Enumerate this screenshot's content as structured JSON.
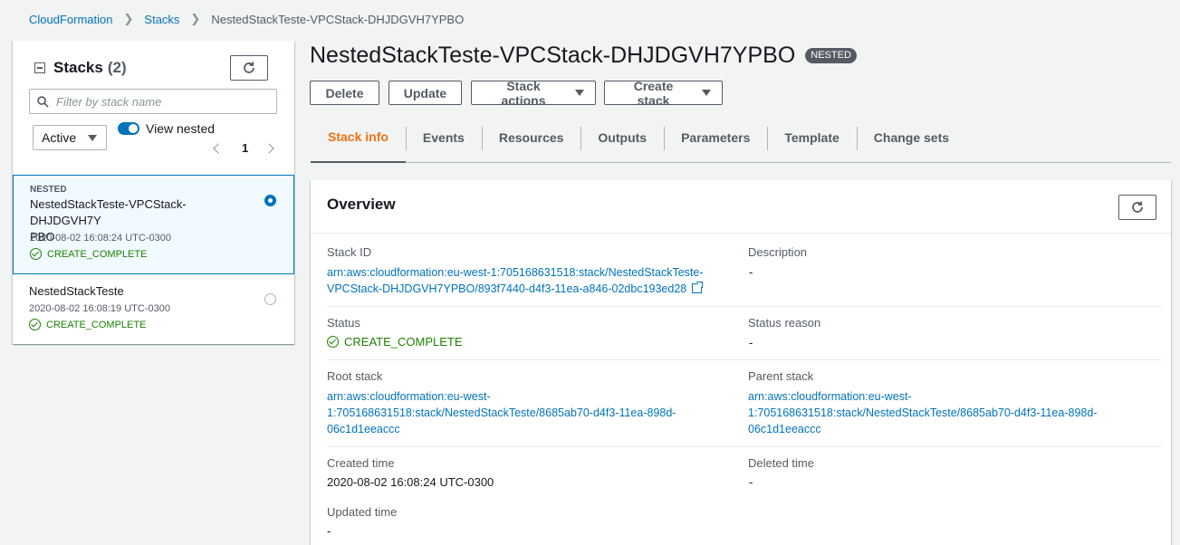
{
  "breadcrumb": {
    "items": [
      "CloudFormation",
      "Stacks"
    ],
    "current": "NestedStackTeste-VPCStack-DHJDGVH7YPBO"
  },
  "sidebar": {
    "title": "Stacks",
    "count": "(2)",
    "search_placeholder": "Filter by stack name",
    "filter_value": "Active",
    "view_nested_label": "View nested",
    "view_nested_on": true,
    "page": "1",
    "stacks": [
      {
        "tag": "NESTED",
        "name": "NestedStackTeste-VPCStack-DHJDGVH7YPBO",
        "name_line1": "NestedStackTeste-VPCStack-DHJDGVH7Y",
        "name_line2": "PBO",
        "date": "2020-08-02 16:08:24 UTC-0300",
        "status": "CREATE_COMPLETE",
        "selected": true
      },
      {
        "tag": "",
        "name": "NestedStackTeste",
        "date": "2020-08-02 16:08:19 UTC-0300",
        "status": "CREATE_COMPLETE",
        "selected": false
      }
    ]
  },
  "header": {
    "title": "NestedStackTeste-VPCStack-DHJDGVH7YPBO",
    "badge": "NESTED"
  },
  "actions": {
    "delete": "Delete",
    "update": "Update",
    "stack_actions": "Stack actions",
    "create_stack": "Create stack"
  },
  "tabs": [
    "Stack info",
    "Events",
    "Resources",
    "Outputs",
    "Parameters",
    "Template",
    "Change sets"
  ],
  "active_tab": "Stack info",
  "overview": {
    "title": "Overview",
    "stack_id_label": "Stack ID",
    "stack_id_line1": "arn:aws:cloudformation:eu-west-1:705168631518:stack/NestedStackTeste-",
    "stack_id_line2": "VPCStack-DHJDGVH7YPBO/893f7440-d4f3-11ea-a846-02dbc193ed28",
    "description_label": "Description",
    "description_value": "-",
    "status_label": "Status",
    "status_value": "CREATE_COMPLETE",
    "status_reason_label": "Status reason",
    "status_reason_value": "-",
    "root_stack_label": "Root stack",
    "root_stack_line1": "arn:aws:cloudformation:eu-west-",
    "root_stack_line2": "1:705168631518:stack/NestedStackTeste/8685ab70-d4f3-11ea-898d-",
    "root_stack_line3": "06c1d1eeaccc",
    "parent_stack_label": "Parent stack",
    "parent_stack_line1": "arn:aws:cloudformation:eu-west-",
    "parent_stack_line2": "1:705168631518:stack/NestedStackTeste/8685ab70-d4f3-11ea-898d-",
    "parent_stack_line3": "06c1d1eeaccc",
    "created_time_label": "Created time",
    "created_time_value": "2020-08-02 16:08:24 UTC-0300",
    "deleted_time_label": "Deleted time",
    "deleted_time_value": "-",
    "updated_time_label": "Updated time",
    "updated_time_value": "-"
  },
  "colors": {
    "link": "#0073bb",
    "active_tab": "#ec7211",
    "success": "#1d8102",
    "selected_bg": "#f1faff"
  }
}
